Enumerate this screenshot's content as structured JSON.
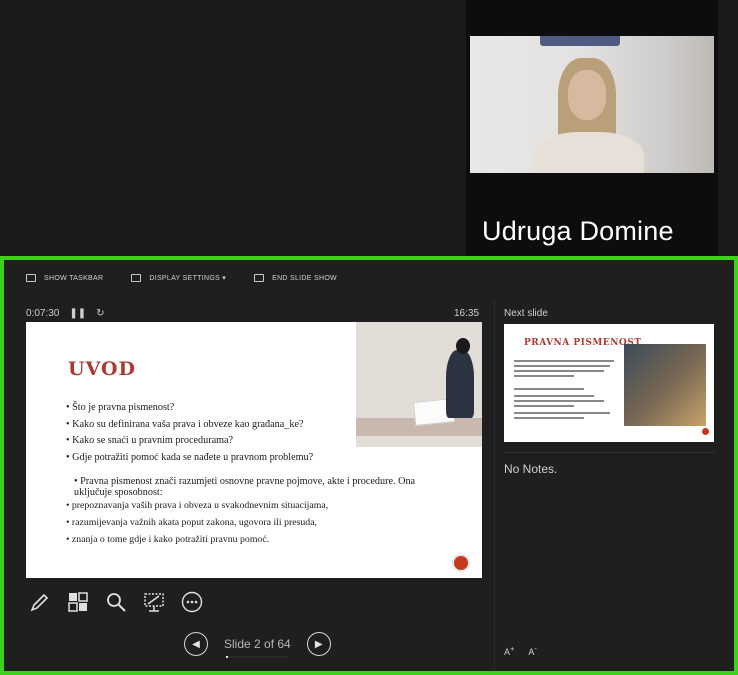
{
  "participant": {
    "name": "Udruga Domine"
  },
  "toolbar": {
    "show_taskbar": "SHOW TASKBAR",
    "display_settings": "DISPLAY SETTINGS ▾",
    "end_slide_show": "END SLIDE SHOW"
  },
  "presenter": {
    "elapsed": "0:07:30",
    "clock": "16:35",
    "next_slide_label": "Next slide",
    "notes": "No Notes.",
    "slide_counter": "Slide 2 of 64",
    "progress_fraction": 0.03125
  },
  "current_slide": {
    "title": "UVOD",
    "bullets": [
      "Što je pravna pismenost?",
      "Kako su definirana vaša prava i obveze kao građana_ke?",
      "Kako se snaći u pravnim procedurama?",
      "Gdje potražiti pomoć kada se nađete u pravnom problemu?"
    ],
    "paragraph": "Pravna pismenost znači razumjeti osnovne pravne pojmove, akte i procedure. Ona uključuje sposobnost:",
    "sub_bullets": [
      "prepoznavanja vaših prava i obveza u svakodnevnim situacijama,",
      "razumijevanja važnih akata poput zakona, ugovora ili presuda,",
      "znanja o tome gdje i kako potražiti pravnu pomoć."
    ]
  },
  "next_slide": {
    "title": "PRAVNA PISMENOST"
  },
  "icons": {
    "pen": "pen-icon",
    "grid": "slides-grid-icon",
    "zoom": "zoom-icon",
    "screen": "screen-icon",
    "more": "more-icon"
  },
  "colors": {
    "active_border": "#3dd11e",
    "slide_title": "#a83c32"
  }
}
